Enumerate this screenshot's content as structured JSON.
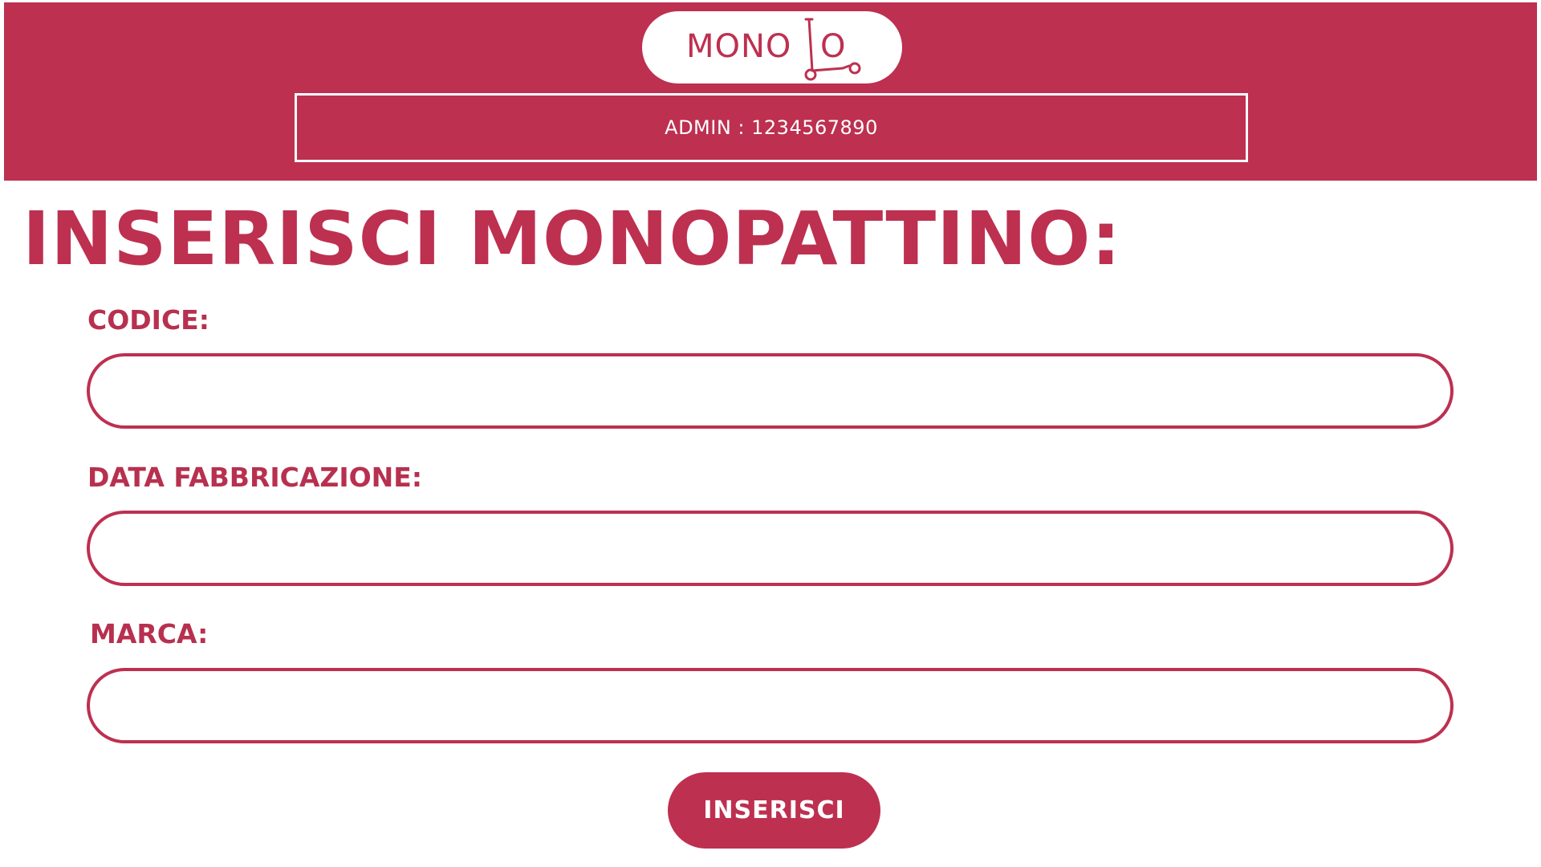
{
  "colors": {
    "brand": "#bd3050",
    "background": "#ffffff",
    "header_text": "#ffffff"
  },
  "header": {
    "logo": {
      "text_left": "MONO",
      "text_right": "O",
      "icon": "scooter-icon"
    },
    "admin_label": "ADMIN : 1234567890"
  },
  "main": {
    "title": "INSERISCI MONOPATTINO:",
    "fields": [
      {
        "label": "CODICE:",
        "value": "",
        "placeholder": ""
      },
      {
        "label": "DATA FABBRICAZIONE:",
        "value": "",
        "placeholder": ""
      },
      {
        "label": "MARCA:",
        "value": "",
        "placeholder": ""
      }
    ],
    "submit_label": "INSERISCI"
  }
}
